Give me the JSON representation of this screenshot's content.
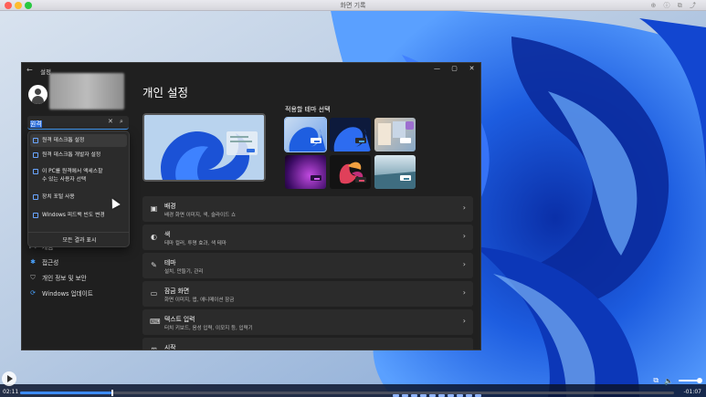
{
  "player": {
    "title": "화면 기록",
    "time_elapsed": "02:11",
    "time_remaining": "-01:07",
    "progress_fraction": 0.14
  },
  "window": {
    "app_title": "설정",
    "controls": [
      "—",
      "▢",
      "✕"
    ]
  },
  "search": {
    "value_selected": "원격",
    "value_rest": "",
    "clear_glyph": "✕"
  },
  "search_results": [
    {
      "label": "원격 데스크톱 설정",
      "icon": "remote-desktop-icon"
    },
    {
      "label": "원격 데스크톱 개발자 설정",
      "icon": "developer-icon"
    },
    {
      "label": "이 PC를 원격에서 액세스할 수 있는 사용자 선택",
      "icon": "users-icon"
    },
    {
      "label": "장치 포털 사용",
      "icon": "device-portal-icon"
    },
    {
      "label": "Windows 피드백 빈도 변경",
      "icon": "feedback-icon"
    }
  ],
  "search_more": "모든 결과 표시",
  "sidebar": {
    "items": [
      {
        "label": "게임",
        "icon": "gaming-icon"
      },
      {
        "label": "접근성",
        "icon": "accessibility-icon"
      },
      {
        "label": "개인 정보 및 보안",
        "icon": "shield-icon"
      },
      {
        "label": "Windows 업데이트",
        "icon": "update-icon"
      }
    ]
  },
  "main": {
    "title": "개인 설정",
    "theme_label": "적용할 테마 선택",
    "cards": [
      {
        "title": "배경",
        "subtitle": "배경 화면 이미지, 색, 슬라이드 쇼",
        "icon": "image-icon"
      },
      {
        "title": "색",
        "subtitle": "테마 컬러, 투명 효과, 색 테마",
        "icon": "palette-icon"
      },
      {
        "title": "테마",
        "subtitle": "설치, 만들기, 관리",
        "icon": "brush-icon"
      },
      {
        "title": "잠금 화면",
        "subtitle": "화면 이미지, 앱, 애니메이션 잠금",
        "icon": "lock-screen-icon"
      },
      {
        "title": "텍스트 입력",
        "subtitle": "터치 키보드, 음성 입력, 이모지 등, 입력기",
        "icon": "keyboard-icon"
      },
      {
        "title": "시작",
        "subtitle": "",
        "icon": "start-icon"
      }
    ]
  },
  "colors": {
    "accent": "#4aa3ff",
    "window_bg": "#202020",
    "card_bg": "#2b2b2b"
  }
}
